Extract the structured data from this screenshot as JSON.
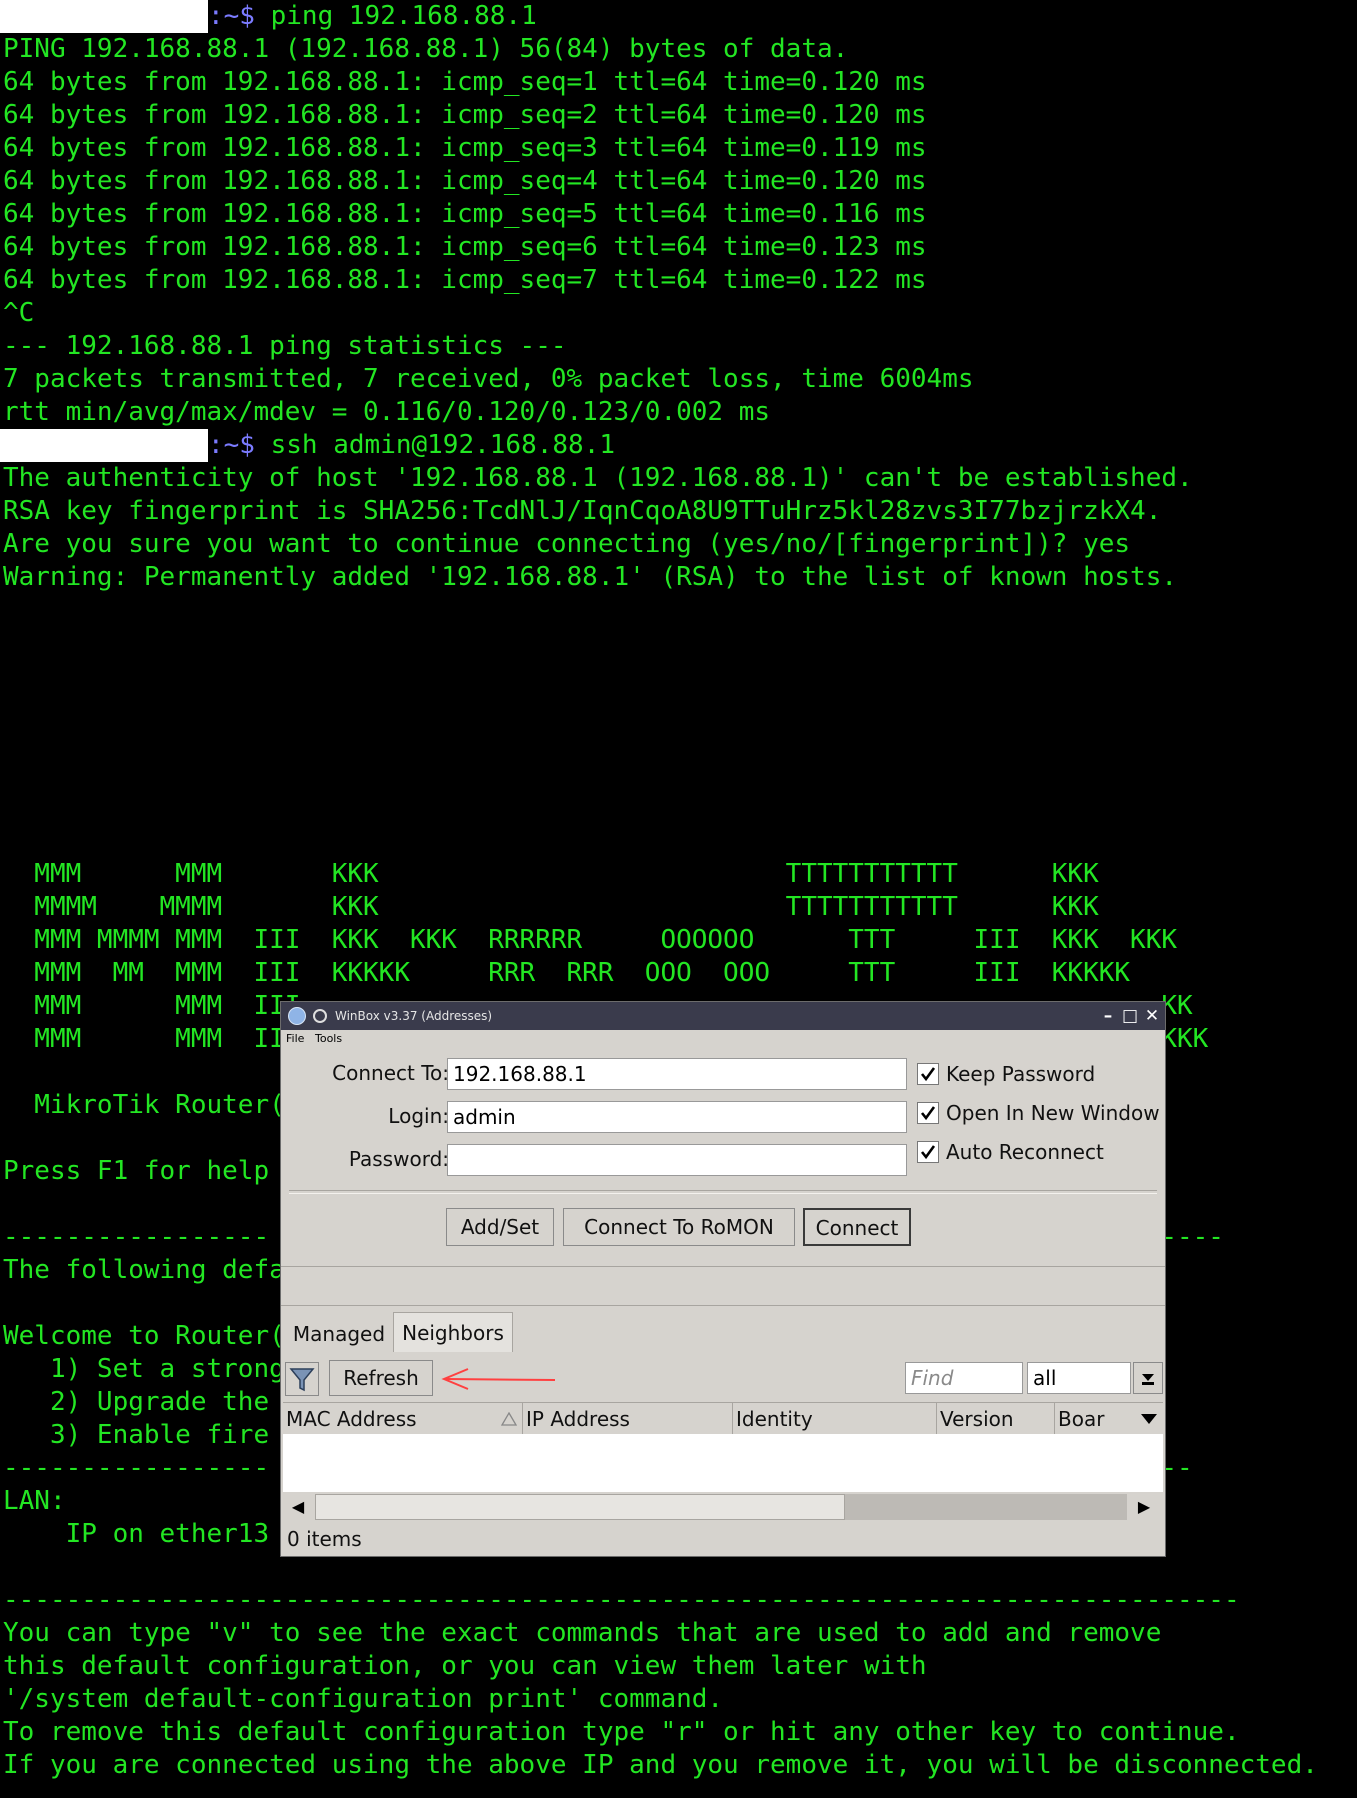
{
  "terminal": {
    "lines": [
      {
        "prompt": ":~$",
        "cmd": " ping 192.168.88.1"
      },
      {
        "text": "PING 192.168.88.1 (192.168.88.1) 56(84) bytes of data."
      },
      {
        "text": "64 bytes from 192.168.88.1: icmp_seq=1 ttl=64 time=0.120 ms"
      },
      {
        "text": "64 bytes from 192.168.88.1: icmp_seq=2 ttl=64 time=0.120 ms"
      },
      {
        "text": "64 bytes from 192.168.88.1: icmp_seq=3 ttl=64 time=0.119 ms"
      },
      {
        "text": "64 bytes from 192.168.88.1: icmp_seq=4 ttl=64 time=0.120 ms"
      },
      {
        "text": "64 bytes from 192.168.88.1: icmp_seq=5 ttl=64 time=0.116 ms"
      },
      {
        "text": "64 bytes from 192.168.88.1: icmp_seq=6 ttl=64 time=0.123 ms"
      },
      {
        "text": "64 bytes from 192.168.88.1: icmp_seq=7 ttl=64 time=0.122 ms"
      },
      {
        "text": "^C"
      },
      {
        "text": "--- 192.168.88.1 ping statistics ---"
      },
      {
        "text": "7 packets transmitted, 7 received, 0% packet loss, time 6004ms"
      },
      {
        "text": "rtt min/avg/max/mdev = 0.116/0.120/0.123/0.002 ms"
      },
      {
        "prompt": ":~$",
        "cmd": " ssh admin@192.168.88.1"
      },
      {
        "text": "The authenticity of host '192.168.88.1 (192.168.88.1)' can't be established."
      },
      {
        "text": "RSA key fingerprint is SHA256:TcdNlJ/IqnCqoA8U9TTuHrz5kl28zvs3I77bzjrzkX4."
      },
      {
        "text": "Are you sure you want to continue connecting (yes/no/[fingerprint])? yes"
      },
      {
        "text": "Warning: Permanently added '192.168.88.1' (RSA) to the list of known hosts."
      },
      {
        "text": ""
      },
      {
        "text": ""
      },
      {
        "text": ""
      },
      {
        "text": ""
      },
      {
        "text": ""
      },
      {
        "text": ""
      },
      {
        "text": ""
      },
      {
        "text": ""
      },
      {
        "text": "  MMM      MMM       KKK                          TTTTTTTTTTT      KKK"
      },
      {
        "text": "  MMMM    MMMM       KKK                          TTTTTTTTTTT      KKK"
      },
      {
        "text": "  MMM MMMM MMM  III  KKK  KKK  RRRRRR     OOOOOO      TTT     III  KKK  KKK"
      },
      {
        "text": "  MMM  MM  MMM  III  KKKKK     RRR  RRR  OOO  OOO     TTT     III  KKKKK"
      },
      {
        "text": "  MMM      MMM  III                                                       KK"
      },
      {
        "text": "  MMM      MMM  III                                                       KKK"
      },
      {
        "text": ""
      },
      {
        "text": "  MikroTik Router("
      },
      {
        "text": ""
      },
      {
        "text": "Press F1 for help"
      },
      {
        "text": ""
      },
      {
        "text": "-----------------                                                       ------"
      },
      {
        "text": "The following defa"
      },
      {
        "text": ""
      },
      {
        "text": "Welcome to Router("
      },
      {
        "text": "   1) Set a strong"
      },
      {
        "text": "   2) Upgrade the"
      },
      {
        "text": "   3) Enable fire"
      },
      {
        "text": "-----------------                                                       ----"
      },
      {
        "text": "LAN:"
      },
      {
        "text": "    IP on ether13"
      },
      {
        "text": ""
      },
      {
        "text": "-------------------------------------------------------------------------------"
      },
      {
        "text": "You can type \"v\" to see the exact commands that are used to add and remove"
      },
      {
        "text": "this default configuration, or you can view them later with"
      },
      {
        "text": "'/system default-configuration print' command."
      },
      {
        "text": "To remove this default configuration type \"r\" or hit any other key to continue."
      },
      {
        "text": "If you are connected using the above IP and you remove it, you will be disconnected."
      }
    ]
  },
  "winbox": {
    "title": "WinBox v3.37 (Addresses)",
    "menu": {
      "file": "File",
      "tools": "Tools"
    },
    "connect_to_label": "Connect To:",
    "connect_to_value": "192.168.88.1",
    "login_label": "Login:",
    "login_value": "admin",
    "password_label": "Password:",
    "password_value": "",
    "keep_password": "Keep Password",
    "open_new_window": "Open In New Window",
    "auto_reconnect": "Auto Reconnect",
    "add_set": "Add/Set",
    "connect_romon": "Connect To RoMON",
    "connect": "Connect",
    "tabs": {
      "managed": "Managed",
      "neighbors": "Neighbors"
    },
    "refresh": "Refresh",
    "find_placeholder": "Find",
    "filter_value": "all",
    "columns": {
      "mac": "MAC Address",
      "ip": "IP Address",
      "identity": "Identity",
      "version": "Version",
      "board": "Boar"
    },
    "items": "0 items"
  },
  "colors": {
    "terminal_green": "#23e623",
    "prompt_blue": "#7b7bff",
    "window_bg": "#d6d3ce",
    "annotation_arrow": "#ff4040"
  }
}
